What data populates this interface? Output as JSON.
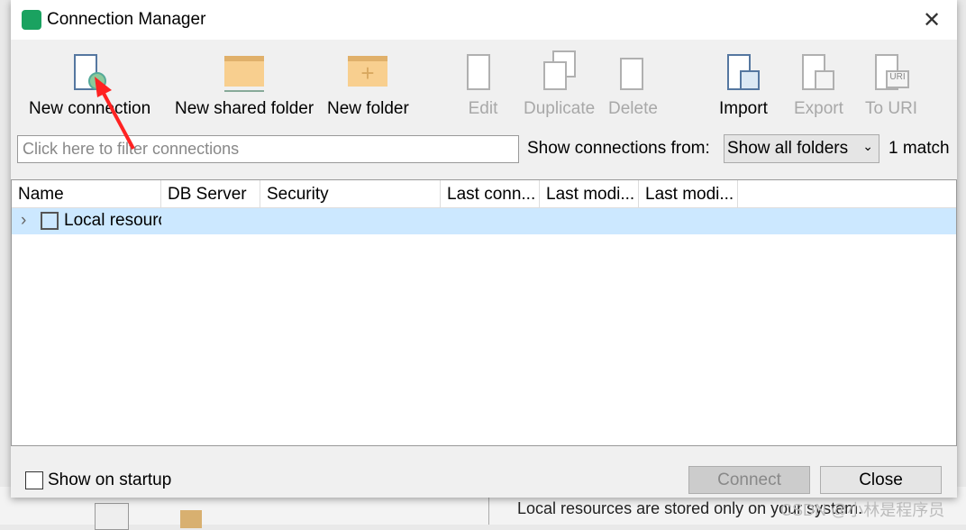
{
  "window": {
    "title": "Connection Manager"
  },
  "toolbar": [
    {
      "label": "New connection",
      "icon": "new-connection-icon",
      "enabled": true
    },
    {
      "label": "New shared folder",
      "icon": "shared-folder-icon",
      "enabled": true
    },
    {
      "label": "New folder",
      "icon": "new-folder-icon",
      "enabled": true
    },
    {
      "label": "Edit",
      "icon": "edit-icon",
      "enabled": false
    },
    {
      "label": "Duplicate",
      "icon": "duplicate-icon",
      "enabled": false
    },
    {
      "label": "Delete",
      "icon": "trash-icon",
      "enabled": false
    },
    {
      "label": "Import",
      "icon": "import-icon",
      "enabled": true
    },
    {
      "label": "Export",
      "icon": "export-icon",
      "enabled": false
    },
    {
      "label": "To URI",
      "icon": "uri-icon",
      "enabled": false,
      "badge": "URI"
    }
  ],
  "filter": {
    "placeholder": "Click here to filter connections",
    "show_from_label": "Show connections from:",
    "selected": "Show all folders",
    "match": "1 match"
  },
  "table": {
    "columns": [
      "Name",
      "DB Server",
      "Security",
      "Last conn...",
      "Last modi...",
      "Last modi..."
    ],
    "rows": [
      {
        "name": "Local resources"
      }
    ]
  },
  "footer": {
    "show_on_startup": "Show on startup",
    "checked": false,
    "connect": "Connect",
    "connect_enabled": false,
    "close": "Close"
  },
  "background": {
    "text": "Local resources are stored only on your system."
  },
  "watermark": "CSDN @小林是程序员"
}
